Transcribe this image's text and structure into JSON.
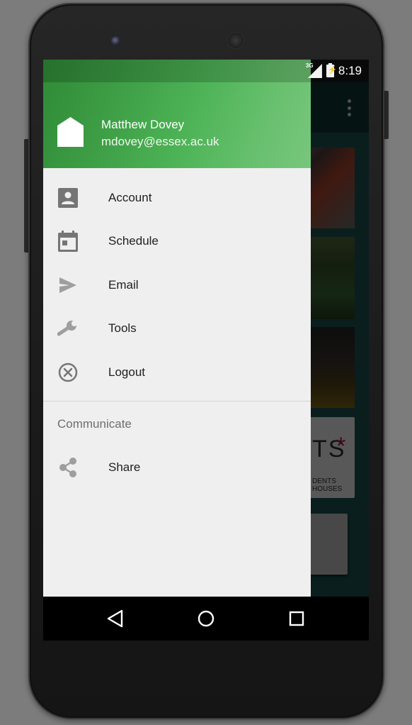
{
  "status_bar": {
    "network_type": "3G",
    "time": "8:19"
  },
  "drawer": {
    "header": {
      "user_name": "Matthew Dovey",
      "user_email": "mdovey@essex.ac.uk"
    },
    "items": [
      {
        "label": "Account",
        "icon": "account-box-icon"
      },
      {
        "label": "Schedule",
        "icon": "calendar-icon"
      },
      {
        "label": "Email",
        "icon": "send-icon"
      },
      {
        "label": "Tools",
        "icon": "wrench-icon"
      },
      {
        "label": "Logout",
        "icon": "cancel-circle-icon"
      }
    ],
    "section_title": "Communicate",
    "section_items": [
      {
        "label": "Share",
        "icon": "share-icon"
      }
    ]
  },
  "background_app": {
    "banner_text": "TS",
    "banner_star": "*",
    "banner_subtext_1": "DENTS",
    "banner_subtext_2": "HOUSES"
  },
  "colors": {
    "header_green": "#4db356",
    "drawer_background": "#efefef",
    "text_primary": "#212121",
    "text_secondary": "#6e6e6e",
    "icon_grey": "#757575"
  }
}
